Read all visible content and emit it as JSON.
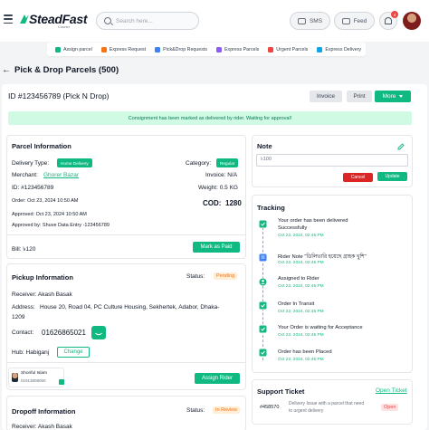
{
  "header": {
    "logo_main": "SteadFast",
    "logo_sub": "Courier",
    "search_placeholder": "Search here...",
    "sms_label": "SMS",
    "feed_label": "Feed",
    "notification_count": "4"
  },
  "quick_nav": [
    {
      "label": "Assign parcel",
      "color": "#10b981"
    },
    {
      "label": "Express Request",
      "color": "#f97316"
    },
    {
      "label": "Pick&Drop Requests",
      "color": "#3b82f6"
    },
    {
      "label": "Express Parcels",
      "color": "#8b5cf6"
    },
    {
      "label": "Urgent Parcels",
      "color": "#ef4444"
    },
    {
      "label": "Express Delivery",
      "color": "#0ea5e9"
    }
  ],
  "page": {
    "back": "←",
    "title": "Pick & Drop Parcels (500)",
    "id_title": "ID #123456789 (Pick N Drop)",
    "invoice_btn": "Invoice",
    "print_btn": "Print",
    "more_btn": "More",
    "alert": "Consignment has been marked as delivered by rider. Waiting for approval!"
  },
  "parcel": {
    "title": "Parcel Information",
    "delivery_type_label": "Delivery Type:",
    "delivery_type": "Home Delivery",
    "category_label": "Category:",
    "category": "Regular",
    "merchant_label": "Merchant:",
    "merchant": "Ghorer Bazar",
    "invoice_label": "Invoice: N/A",
    "id_label": "ID: #123456789",
    "weight_label": "Weight: 0.5 KG",
    "order_time": "Order: Oct 23, 2024  10:50 AM",
    "cod_label": "COD:",
    "cod_value": "1280",
    "approved_time": "Approved: Oct 23, 2024  10:50 AM",
    "approved_by": "Approved by: Shuve Data Entry -123456789",
    "bill": "Bill: ৳120",
    "mark_paid": "Mark as Paid"
  },
  "pickup": {
    "title": "Pickup Information",
    "status_label": "Status:",
    "status": "Pending",
    "receiver": "Receiver: Akash Basak",
    "address_label": "Address:",
    "address_line1": "House 20, Road 04, PC Culture Housing, Sekhertek, Adabor, Dhaka-",
    "address_line2": "1209",
    "contact_label": "Contact:",
    "contact": "01626865021",
    "hub": "Hub: Habiganj",
    "change": "Change",
    "rider_name": "Shoriful Islam",
    "rider_phone": "01913808060",
    "assign_rider": "Assign Rider"
  },
  "dropoff": {
    "title": "Dropoff Information",
    "status_label": "Status:",
    "status": "In Review",
    "receiver": "Receiver: Akash Basak"
  },
  "note": {
    "title": "Note",
    "value": "৳100",
    "cancel": "Cancel",
    "update": "Update"
  },
  "tracking": {
    "title": "Tracking",
    "items": [
      {
        "title": "Your order has been delivered",
        "title2": "Successfully",
        "date": "Oct 22, 2024, 02:45 PM"
      },
      {
        "title": "Rider Note  \"ডিলিভারি হয়েছে গ্রাহক খুশি\"",
        "title2": "",
        "date": "Oct 22, 2024, 02:45 PM"
      },
      {
        "title": "Assigned to Rider",
        "title2": "",
        "date": "Oct 22, 2024, 02:45 PM"
      },
      {
        "title": "Order In Transit",
        "title2": "",
        "date": "Oct 22, 2024, 02:45 PM"
      },
      {
        "title": "Your Order is waiting for Acceptance",
        "title2": "",
        "date": "Oct 22, 2024, 02:45 PM"
      },
      {
        "title": "Order has been Placed",
        "title2": "",
        "date": "Oct 22, 2024, 02:45 PM"
      }
    ]
  },
  "support": {
    "title": "Support Ticket",
    "open_ticket": "Open Ticket",
    "ticket_id": "#458570",
    "ticket_line1": "Delivery Issue with a parcel that need",
    "ticket_line2": "to urgent delivery",
    "ticket_status": "Open"
  }
}
